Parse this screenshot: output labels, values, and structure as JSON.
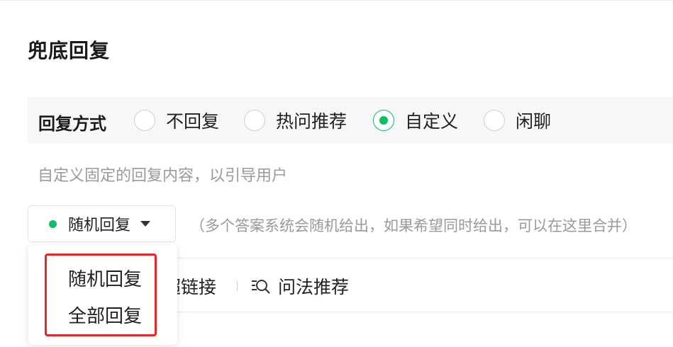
{
  "section": {
    "title": "兜底回复"
  },
  "reply_mode": {
    "label": "回复方式",
    "options": [
      {
        "label": "不回复",
        "selected": false
      },
      {
        "label": "热问推荐",
        "selected": false
      },
      {
        "label": "自定义",
        "selected": true
      },
      {
        "label": "闲聊",
        "selected": false
      }
    ]
  },
  "hint": "自定义固定的回复内容，以引导用户",
  "dropdown": {
    "selected": "随机回复",
    "note": "（多个答案系统会随机给出，如果希望同时给出，可以在这里合并）",
    "options": [
      "随机回复",
      "全部回复"
    ]
  },
  "toolbar": {
    "link_label": "超链接",
    "faq_label": "问法推荐",
    "faq_icon": "search-list-icon"
  },
  "colors": {
    "accent": "#07c160",
    "highlight": "#e8262a",
    "hint": "#9a9a9a"
  }
}
